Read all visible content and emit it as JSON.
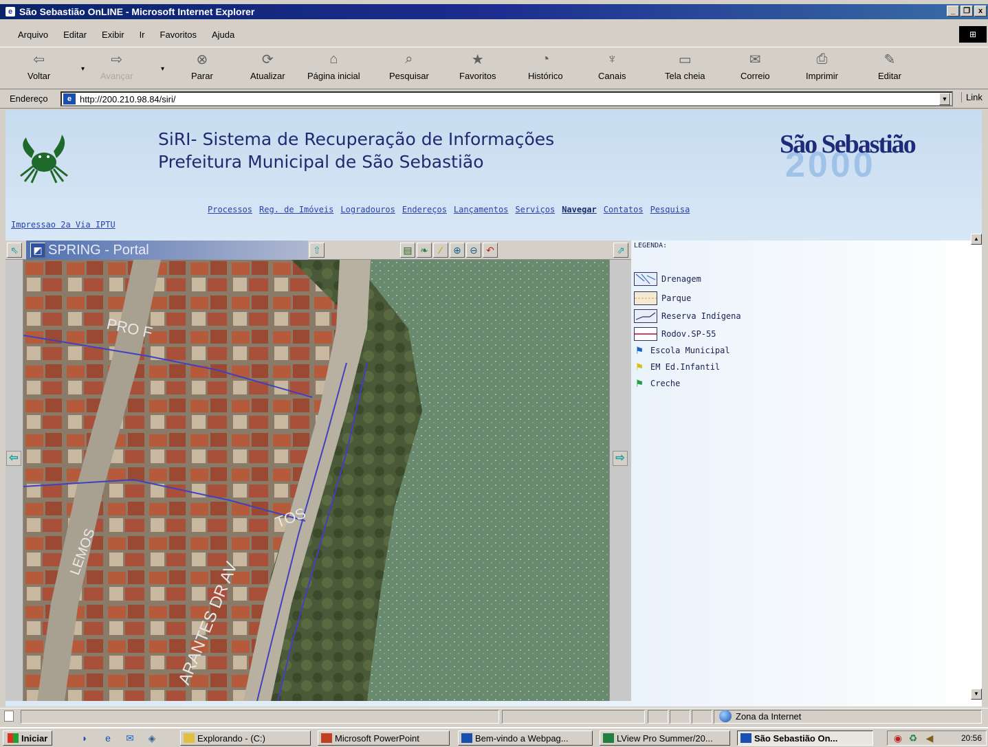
{
  "window": {
    "title": "São Sebastião OnLINE - Microsoft Internet Explorer",
    "controls": [
      "_",
      "❐",
      "x"
    ]
  },
  "menubar": {
    "items": [
      "Arquivo",
      "Editar",
      "Exibir",
      "Ir",
      "Favoritos",
      "Ajuda"
    ]
  },
  "toolbar": {
    "buttons": [
      {
        "label": "Voltar",
        "icon": "back-arrow-icon",
        "glyph": "⇦"
      },
      {
        "label": "Avançar",
        "icon": "forward-arrow-icon",
        "glyph": "⇨"
      },
      {
        "label": "Parar",
        "icon": "stop-icon",
        "glyph": "⊗"
      },
      {
        "label": "Atualizar",
        "icon": "refresh-icon",
        "glyph": "⟳"
      },
      {
        "label": "Página inicial",
        "icon": "home-icon",
        "glyph": "⌂"
      },
      {
        "label": "Pesquisar",
        "icon": "search-icon",
        "glyph": "⌕"
      },
      {
        "label": "Favoritos",
        "icon": "favorites-icon",
        "glyph": "★"
      },
      {
        "label": "Histórico",
        "icon": "history-icon",
        "glyph": "◔"
      },
      {
        "label": "Canais",
        "icon": "channels-icon",
        "glyph": "♆"
      },
      {
        "label": "Tela cheia",
        "icon": "fullscreen-icon",
        "glyph": "▭"
      },
      {
        "label": "Correio",
        "icon": "mail-icon",
        "glyph": "✉"
      },
      {
        "label": "Imprimir",
        "icon": "print-icon",
        "glyph": "⎙"
      },
      {
        "label": "Editar",
        "icon": "edit-icon",
        "glyph": "✎"
      }
    ]
  },
  "address": {
    "label": "Endereço",
    "url": "http://200.210.98.84/siri/",
    "links_label": "Link"
  },
  "page": {
    "title_line1": "SiRI- Sistema de Recuperação de Informações",
    "title_line2": "Prefeitura Municipal de São Sebastião",
    "logo_name": "São Sebastião",
    "logo_year": "2000",
    "nav": [
      "Processos",
      "Reg. de Imóveis",
      "Logradouros",
      "Endereços",
      "Lançamentos",
      "Serviços",
      "Navegar",
      "Contatos",
      "Pesquisa"
    ],
    "nav_current": "Navegar",
    "iptu_link": "Impressao 2a Via IPTU"
  },
  "map": {
    "portal_title": "SPRING - Portal",
    "street_labels": [
      "PRO F",
      "ARANTES DR AV",
      "TOS",
      "LEMOS"
    ]
  },
  "legend": {
    "title": "LEGENDA:",
    "items": [
      {
        "label": "Drenagem",
        "kind": "swatch"
      },
      {
        "label": "Parque",
        "kind": "swatch"
      },
      {
        "label": "Reserva Indígena",
        "kind": "swatch"
      },
      {
        "label": "Rodov.SP-55",
        "kind": "swatch"
      },
      {
        "label": "Escola Municipal",
        "kind": "flag",
        "color": "#1a60d0"
      },
      {
        "label": "EM Ed.Infantil",
        "kind": "flag",
        "color": "#e0d020"
      },
      {
        "label": "Creche",
        "kind": "flag",
        "color": "#20a040"
      }
    ]
  },
  "status": {
    "zone": "Zona da Internet"
  },
  "taskbar": {
    "start": "Iniciar",
    "tasks": [
      "Explorando - (C:)",
      "Microsoft PowerPoint",
      "Bem-vindo a Webpag...",
      "LView Pro Summer/20...",
      "São Sebastião On..."
    ],
    "active_task": "São Sebastião On...",
    "clock": "20:56"
  }
}
